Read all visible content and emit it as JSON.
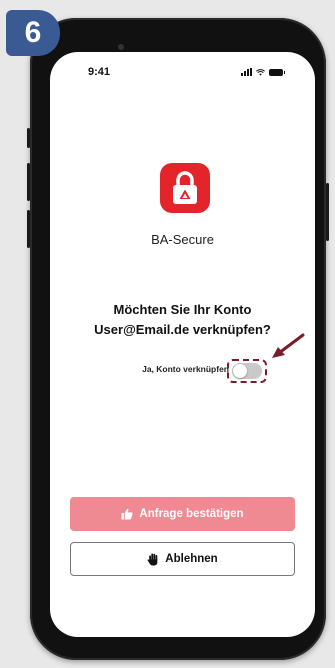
{
  "step": {
    "number": "6",
    "color": "#3a5a94"
  },
  "status_bar": {
    "time": "9:41",
    "icons": [
      "signal-icon",
      "wifi-icon",
      "battery-icon"
    ]
  },
  "app": {
    "name": "BA-Secure",
    "icon": "lock-logo-icon",
    "brand_color": "#e3242b"
  },
  "prompt": {
    "line1": "Möchten Sie Ihr Konto",
    "line2": "User@Email.de verknüpfen?"
  },
  "link_toggle": {
    "label": "Ja, Konto verknüpfen",
    "state": "off",
    "highlight_color": "#7a1c2a"
  },
  "buttons": {
    "confirm": {
      "label": "Anfrage bestätigen",
      "icon": "thumbs-up-icon",
      "color": "#ef8a92"
    },
    "decline": {
      "label": "Ablehnen",
      "icon": "hand-stop-icon"
    }
  }
}
